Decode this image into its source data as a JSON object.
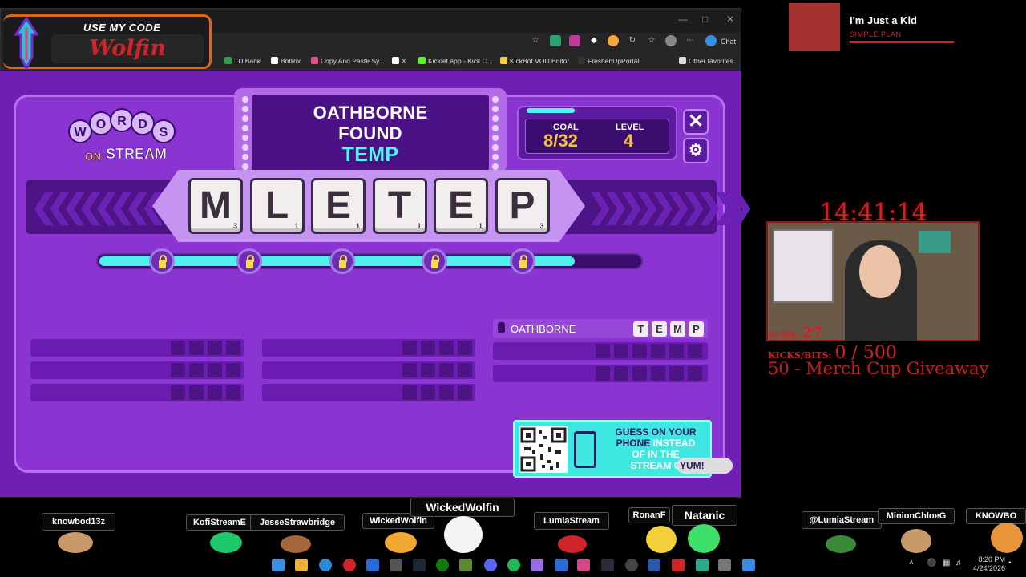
{
  "browser": {
    "chat_label": "Chat",
    "favorites": [
      {
        "label": "TD Bank",
        "color": "#2ea043"
      },
      {
        "label": "BotRix",
        "color": "#ffffff"
      },
      {
        "label": "Copy And Paste Sy...",
        "color": "#e84d8a"
      },
      {
        "label": "X",
        "color": "#ffffff"
      },
      {
        "label": "Kicklet.app - Kick C...",
        "color": "#53fc18"
      },
      {
        "label": "KickBot VOD Editor",
        "color": "#f4d03f"
      },
      {
        "label": "FreshenUpPortal",
        "color": "#333333"
      },
      {
        "label": "Other favorites",
        "color": "#dddddd"
      }
    ]
  },
  "code_badge": {
    "use_label": "USE MY CODE",
    "code": "Wolfin"
  },
  "game": {
    "logo": {
      "line1": "WORDS",
      "line2": "ON",
      "line3": "STREAM"
    },
    "found": {
      "player": "OATHBORNE",
      "verb": "FOUND",
      "word": "TEMP"
    },
    "goal": {
      "label": "GOAL",
      "value": "8/32"
    },
    "level": {
      "label": "LEVEL",
      "value": "4"
    },
    "close_icon": "close-icon",
    "settings_icon": "gear-icon",
    "tiles": [
      {
        "letter": "M",
        "score": "3"
      },
      {
        "letter": "L",
        "score": "1"
      },
      {
        "letter": "E",
        "score": "1"
      },
      {
        "letter": "T",
        "score": "1"
      },
      {
        "letter": "E",
        "score": "1"
      },
      {
        "letter": "P",
        "score": "3"
      }
    ],
    "progress": 0.88,
    "found_word_row": {
      "player": "OATHBORNE",
      "letters": [
        "T",
        "E",
        "M",
        "P"
      ]
    },
    "qr_card": {
      "line1": "GUESS ON YOUR",
      "line2a": "PHONE",
      "line2b": "INSTEAD",
      "line3": "OF IN THE",
      "line4": "STREAM C",
      "yum": "YUM!"
    }
  },
  "overlay": {
    "song_title": "I'm Just a Kid",
    "song_artist": "SIMPLE PLAN",
    "clock": "14:41:14",
    "subs_label": "SUBS:",
    "subs_value": "27",
    "kicks_label": "KICKS/BITS:",
    "kicks_value": "0 / 500",
    "giveaway": "50 - Merch Cup Giveaway"
  },
  "chatters": [
    "knowbod13z",
    "KofiStreamE",
    "JesseStrawbridge",
    "WickedWolfin",
    "WickedWolfin",
    "LumiaStream",
    "RonanF",
    "Natanic",
    "@LumiaStream",
    "MinionChloeG",
    "KNOWBO"
  ],
  "taskbar": {
    "time": "8:20 PM",
    "date": "4/24/2026"
  }
}
